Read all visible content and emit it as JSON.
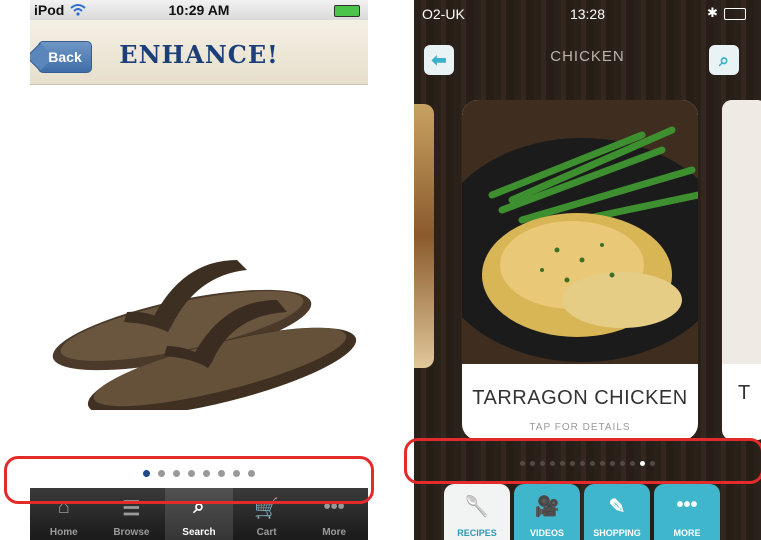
{
  "left_app": {
    "status": {
      "carrier": "iPod",
      "time": "10:29 AM"
    },
    "nav": {
      "back_label": "Back",
      "title": "ENHANCE!"
    },
    "pager": {
      "count": 8,
      "active": 0
    },
    "tabs": [
      {
        "label": "Home",
        "icon": "home-icon"
      },
      {
        "label": "Browse",
        "icon": "list-icon"
      },
      {
        "label": "Search",
        "icon": "search-icon",
        "selected": true
      },
      {
        "label": "Cart",
        "icon": "cart-icon"
      },
      {
        "label": "More",
        "icon": "more-icon"
      }
    ]
  },
  "right_app": {
    "status": {
      "carrier": "O2-UK",
      "time": "13:28"
    },
    "nav": {
      "title": "CHICKEN"
    },
    "card": {
      "title": "TARRAGON CHICKEN",
      "subtitle": "TAP FOR DETAILS"
    },
    "next_card_initial": "T",
    "pager": {
      "count": 14,
      "active": 12
    },
    "tabs": [
      {
        "label": "RECIPES",
        "icon": "spoon-icon",
        "selected": true
      },
      {
        "label": "VIDEOS",
        "icon": "video-camera-icon"
      },
      {
        "label": "SHOPPING",
        "icon": "pencil-icon"
      },
      {
        "label": "MORE",
        "icon": "more-icon"
      }
    ]
  },
  "colors": {
    "highlight": "#e32b2b",
    "left_accent": "#1c4a87",
    "right_accent": "#3fb6cc"
  }
}
